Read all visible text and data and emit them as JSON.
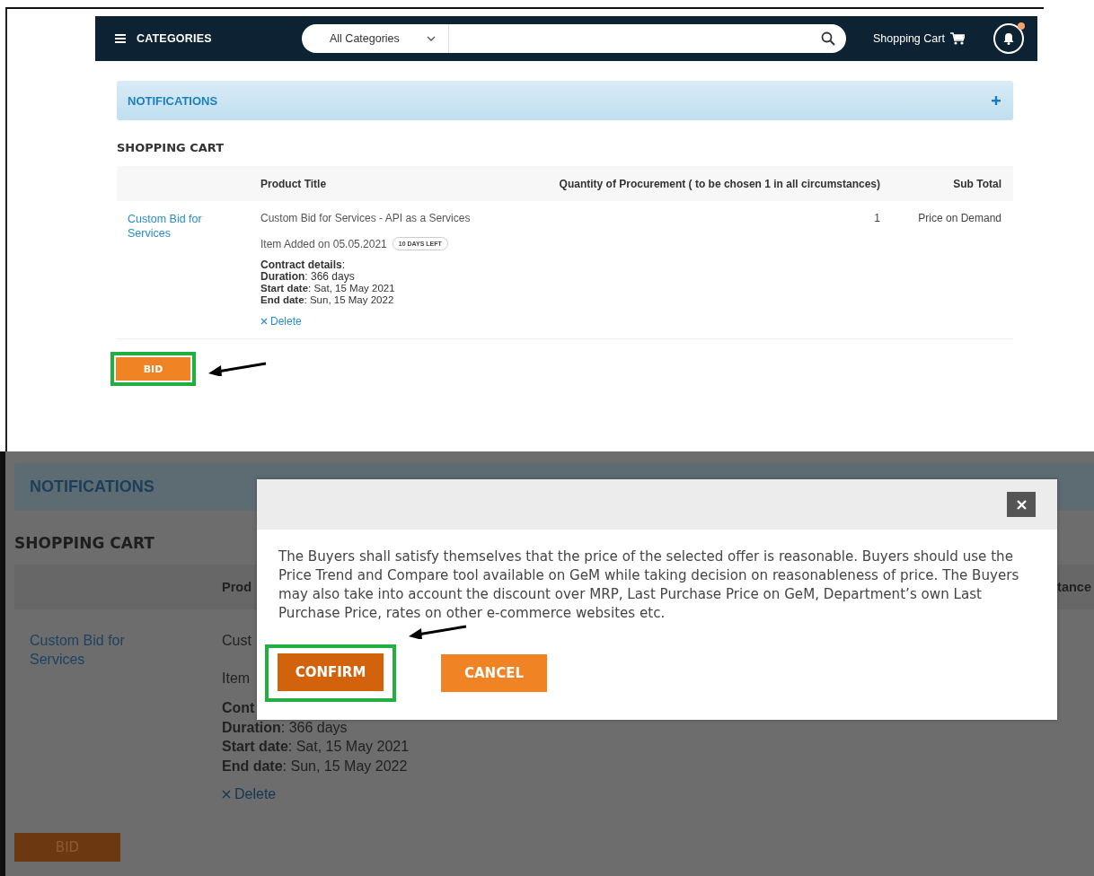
{
  "top": {
    "navbar": {
      "menu_label": "CATEGORIES",
      "category_select": "All Categories",
      "cart_label": "Shopping Cart",
      "has_new_notification": true
    },
    "notifications": {
      "title": "NOTIFICATIONS",
      "expanded": false
    },
    "cart_title": "SHOPPING CART",
    "columns": [
      "Product Title",
      "Quantity of Procurement ( to be chosen 1 in all circumstances)",
      "Sub Total"
    ],
    "rows": [
      {
        "image_alt": "Custom Bid for Services",
        "title": "Custom Bid for Services - API as a Services",
        "added": "Item Added on 05.05.2021",
        "badge": "10 DAYS LEFT",
        "details_heading": "**Contract details**:",
        "details": [
          "**Duration**: 366 days",
          "**Start date**: Sat, 15 May 2021",
          "**End date**: Sun, 15 May 2022"
        ],
        "delete": "Delete",
        "quantity": "1",
        "subtotal": "Price on Demand"
      }
    ],
    "bid_button": {
      "label": "BID",
      "highlighted": true
    }
  },
  "bottom": {
    "notifications": {
      "title": "NOTIFICATIONS"
    },
    "cart_title": "SHOPPING CART",
    "column_fragments": [
      "Prod",
      "tance"
    ],
    "row": {
      "image_alt": "Custom Bid for Services",
      "title": "Cust",
      "added": "Item",
      "details_heading": "Cont",
      "details": [
        "**Duration**: 366 days",
        "**Start date**: Sat, 15 May 2021",
        "**End date**: Sun, 15 May 2022"
      ],
      "delete": "Delete"
    },
    "bid_button": {
      "label": "BID"
    },
    "modal": {
      "message": "The Buyers shall satisfy themselves that the price of the selected offer is reasonable. Buyers should use the Price Trend and Compare tool available on GeM while taking decision on reasonableness of price. The Buyers may also take into account the discount over MRP, Last Purchase Price on GeM, Department’s own Last Purchase Price, rates on other e-commerce websites etc.",
      "buttons": [
        {
          "label": "CONFIRM",
          "kind": "primary",
          "highlighted": true
        },
        {
          "label": "CANCEL",
          "kind": "secondary",
          "highlighted": false
        }
      ]
    }
  }
}
